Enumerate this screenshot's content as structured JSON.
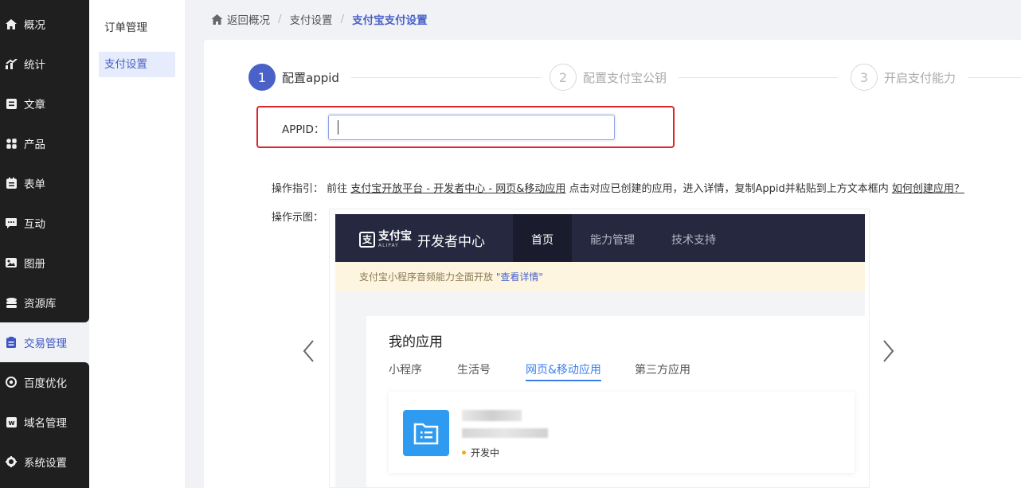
{
  "sidebar": {
    "items": [
      {
        "label": "概况",
        "icon": "home-icon"
      },
      {
        "label": "统计",
        "icon": "stats-icon"
      },
      {
        "label": "文章",
        "icon": "article-icon"
      },
      {
        "label": "产品",
        "icon": "product-icon"
      },
      {
        "label": "表单",
        "icon": "form-icon"
      },
      {
        "label": "互动",
        "icon": "chat-icon"
      },
      {
        "label": "图册",
        "icon": "gallery-icon"
      },
      {
        "label": "资源库",
        "icon": "database-icon"
      },
      {
        "label": "交易管理",
        "icon": "clipboard-icon",
        "active": true
      },
      {
        "label": "百度优化",
        "icon": "seo-icon"
      },
      {
        "label": "域名管理",
        "icon": "domain-icon"
      },
      {
        "label": "系统设置",
        "icon": "gear-icon"
      }
    ]
  },
  "submenu": {
    "items": [
      {
        "label": "订单管理"
      },
      {
        "label": "支付设置",
        "active": true
      }
    ]
  },
  "breadcrumb": {
    "home": "返回概况",
    "level1": "支付设置",
    "current": "支付宝支付设置"
  },
  "steps": [
    {
      "number": "1",
      "label": "配置appid",
      "active": true
    },
    {
      "number": "2",
      "label": "配置支付宝公钥"
    },
    {
      "number": "3",
      "label": "开启支付能力"
    }
  ],
  "form": {
    "appid_label": "APPID：",
    "appid_value": ""
  },
  "guide": {
    "label": "操作指引：",
    "prefix": "前往 ",
    "link1": "支付宝开放平台 - 开发者中心 - 网页&移动应用",
    "middle": " 点击对应已创建的应用，进入详情，复制Appid并粘贴到上方文本框内 ",
    "link2": "如何创建应用？"
  },
  "demo": {
    "label": "操作示图：",
    "logo_text": "支付宝",
    "logo_sub": "ALIPAY",
    "dev_title": "开发者中心",
    "nav": [
      "首页",
      "能力管理",
      "技术支持"
    ],
    "notice": "支付宝小程序音频能力全面开放",
    "notice_link": "\"查看详情\"",
    "app_title": "我的应用",
    "tabs": [
      "小程序",
      "生活号",
      "网页&移动应用",
      "第三方应用"
    ],
    "status": "开发中"
  },
  "colors": {
    "accent": "#4a62c8",
    "sidebar_bg": "#1f1f1f",
    "highlight_border": "#e0252a"
  }
}
